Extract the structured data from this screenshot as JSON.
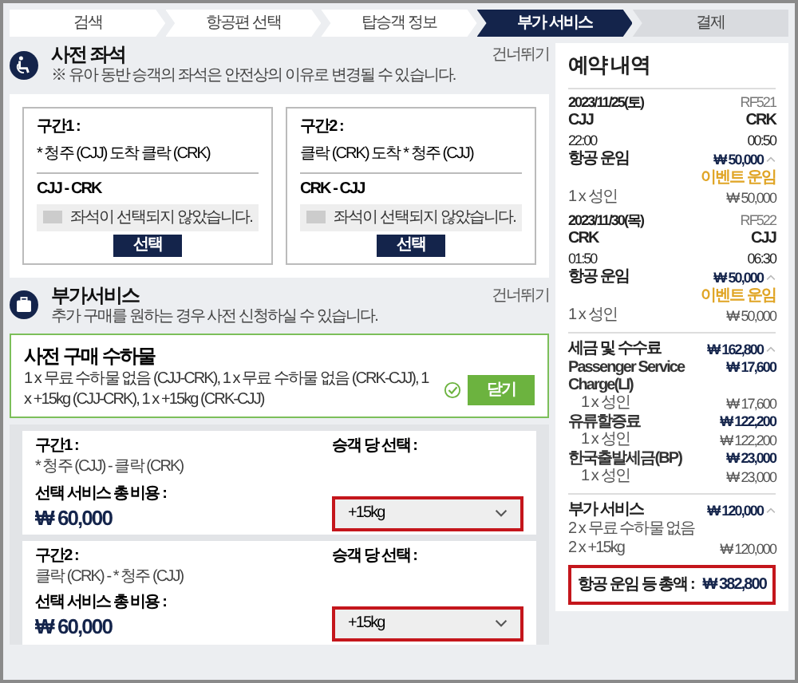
{
  "steps": [
    {
      "label": "검색",
      "selected": false,
      "completed": true
    },
    {
      "label": "항공편 선택",
      "selected": false,
      "completed": true
    },
    {
      "label": "탑승객 정보",
      "selected": false,
      "completed": true
    },
    {
      "label": "부가 서비스",
      "selected": true,
      "completed": false
    },
    {
      "label": "결제",
      "selected": false,
      "completed": false
    }
  ],
  "seat_section": {
    "title": "사전 좌석",
    "note": "※ 유아 동반 승객의 좌석은 안전상의 이유로 변경될 수 있습니다.",
    "skip_link": "건너뛰기",
    "segments": [
      {
        "label": "구간1 :",
        "route": "* 청주 (CJJ) 도착 클락 (CRK)",
        "code": "CJJ - CRK",
        "status": "좌석이 선택되지 않았습니다.",
        "button": "선택"
      },
      {
        "label": "구간2 :",
        "route": "클락 (CRK) 도착 * 청주 (CJJ)",
        "code": "CRK - CJJ",
        "status": "좌석이 선택되지 않았습니다.",
        "button": "선택"
      }
    ]
  },
  "baggage_section": {
    "title": "부가서비스",
    "note": "추가 구매를 원하는 경우 사전 신청하실 수 있습니다.",
    "skip_link": "건너뛰기",
    "panel": {
      "title": "사전 구매 수하물",
      "summary": "1 x 무료 수하물 없음 (CJJ-CRK), 1 x 무료 수하물 없음 (CRK-CJJ), 1 x +15kg (CJJ-CRK), 1 x +15kg (CRK-CJJ)",
      "completed": true,
      "close_button": "닫기"
    },
    "segments": [
      {
        "label": "구간1 :",
        "route": "* 청주 (CJJ) - 클락 (CRK)",
        "select_label": "승객 당 선택 :",
        "total_label": "선택 서비스 총 비용 :",
        "total": "₩ 60,000",
        "selected_option": "+15kg",
        "highlighted": true
      },
      {
        "label": "구간2 :",
        "route": "클락 (CRK) - * 청주 (CJJ)",
        "select_label": "승객 당 선택 :",
        "total_label": "선택 서비스 총 비용 :",
        "total": "₩ 60,000",
        "selected_option": "+15kg",
        "highlighted": true
      }
    ]
  },
  "summary": {
    "title": "예약 내역",
    "flights": [
      {
        "date": "2023/11/25(토)",
        "flight_no": "RF521",
        "from": "CJJ",
        "to": "CRK",
        "dep_time": "22:00",
        "arr_time": "00:50",
        "fare_label": "항공 운임",
        "fare": "₩ 50,000",
        "expanded": true,
        "fare_tag": "이벤트 운임",
        "pax": "1 x 성인",
        "pax_amount": "₩ 50,000"
      },
      {
        "date": "2023/11/30(목)",
        "flight_no": "RF522",
        "from": "CRK",
        "to": "CJJ",
        "dep_time": "01:50",
        "arr_time": "06:30",
        "fare_label": "항공 운임",
        "fare": "₩ 50,000",
        "expanded": true,
        "fare_tag": "이벤트 운임",
        "pax": "1 x 성인",
        "pax_amount": "₩ 50,000"
      }
    ],
    "taxes": {
      "label": "세금 및 수수료",
      "amount": "₩ 162,800",
      "expanded": true,
      "items": [
        {
          "name": "Passenger Service Charge(LI)",
          "amount": "₩ 17,600",
          "pax": "1 x 성인",
          "pax_amount": "₩ 17,600"
        },
        {
          "name": "유류할증료",
          "amount": "₩ 122,200",
          "pax": "1 x 성인",
          "pax_amount": "₩ 122,200"
        },
        {
          "name": "한국출발세금(BP)",
          "amount": "₩ 23,000",
          "pax": "1 x 성인",
          "pax_amount": "₩ 23,000"
        }
      ]
    },
    "extras": {
      "label": "부가 서비스",
      "amount": "₩ 120,000",
      "expanded": true,
      "lines": [
        {
          "text": "2 x 무료 수하물 없음"
        },
        {
          "text": "2 x +15kg",
          "amount": "₩ 120,000"
        }
      ]
    },
    "total": {
      "label": "항공 운임 등 총액 :",
      "amount": "₩ 382,800",
      "highlighted": true
    }
  }
}
